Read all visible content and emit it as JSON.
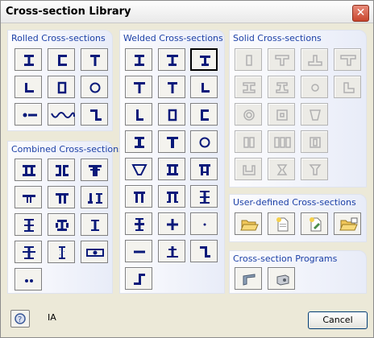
{
  "window": {
    "title": "Cross-section Library",
    "close_glyph": "✕"
  },
  "panels": {
    "rolled": {
      "title": "Rolled Cross-sections"
    },
    "combined": {
      "title": "Combined Cross-sections"
    },
    "welded": {
      "title": "Welded Cross-sections"
    },
    "solid": {
      "title": "Solid Cross-sections"
    },
    "user_defined": {
      "title": "User-defined Cross-sections"
    },
    "programs": {
      "title": "Cross-section Programs"
    }
  },
  "status": {
    "text": "IA"
  },
  "buttons": {
    "cancel": "Cancel"
  },
  "colors": {
    "panel_title": "#1b3fa6",
    "icon_blue": "#0a1a7a",
    "icon_disabled": "#b0b0b0"
  }
}
